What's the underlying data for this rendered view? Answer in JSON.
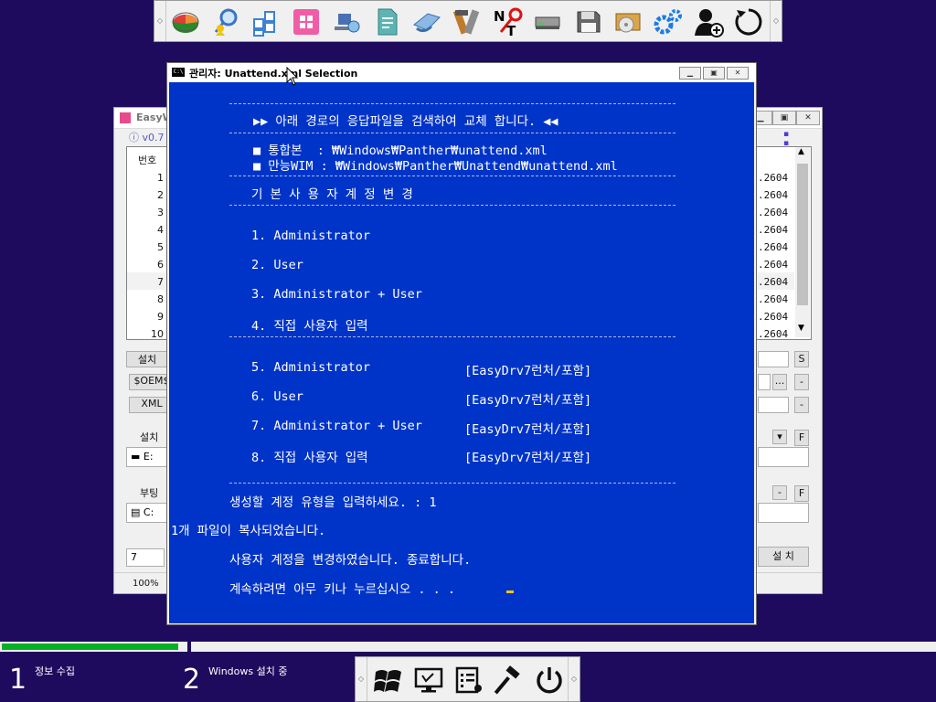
{
  "top_toolbar": {
    "icons": [
      "partition-icon",
      "search-user-icon",
      "tiles-icon",
      "windows-logo-icon",
      "network-icon",
      "document-icon",
      "driver-icon",
      "tools-icon",
      "nt-key-icon",
      "drive-icon",
      "floppy-icon",
      "disc-box-icon",
      "gears-icon",
      "add-user-icon",
      "refresh-icon"
    ]
  },
  "background_window": {
    "title": "EasyW",
    "version": "ⓘ v0.7",
    "list_header": "번호",
    "row_numbers": [
      "1",
      "2",
      "3",
      "4",
      "5",
      "6",
      "7",
      "8",
      "9",
      "10"
    ],
    "row_values": [
      ".2604",
      ".2604",
      ".2604",
      ".2604",
      ".2604",
      ".2604",
      ".2604",
      ".2604",
      ".2604",
      ".2604"
    ],
    "labels": {
      "install1": "설치",
      "oem": "$OEM$",
      "xml": "XML",
      "install2": "설치",
      "drive_e": "E:",
      "boot": "부팅",
      "drive_c": "C:",
      "count": "7",
      "install_button": "설 치",
      "zoom": "100%",
      "s": "S",
      "browse": "...",
      "minus": "-",
      "f": "F",
      "dropdown": "▾"
    }
  },
  "console": {
    "title": "관리자: Unattend.xml Selection",
    "rule": "----------------------------------------------------------------------",
    "header_line": "▶▶ 아래 경로의 응답파일을 검색하여 교체 합니다. ◀◀",
    "path1": "■ 통합본  : ₩Windows₩Panther₩unattend.xml",
    "path2": "■ 만능WIM : ₩Windows₩Panther₩Unattend₩unattend.xml",
    "section_title": "기 본 사 용 자 계 정 변 경",
    "options": [
      {
        "label": "1. Administrator",
        "tag": ""
      },
      {
        "label": "2. User",
        "tag": ""
      },
      {
        "label": "3. Administrator + User",
        "tag": ""
      },
      {
        "label": "4. 직접 사용자 입력",
        "tag": ""
      },
      {
        "label": "5. Administrator",
        "tag": "[EasyDrv7런처/포함]"
      },
      {
        "label": "6. User",
        "tag": "[EasyDrv7런처/포함]"
      },
      {
        "label": "7. Administrator + User",
        "tag": "[EasyDrv7런처/포함]"
      },
      {
        "label": "8. 직접 사용자 입력",
        "tag": "[EasyDrv7런처/포함]"
      }
    ],
    "prompt": "생성할 계정 유형을 입력하세요. : 1",
    "copied": "1개 파일이 복사되었습니다.",
    "changed": "사용자 계정을 변경하였습니다. 종료합니다.",
    "press_key": "계속하려면 아무 키나 누르십시오 . . ."
  },
  "progress": {
    "step1_number": "1",
    "step1_label": "정보 수집",
    "step1_fraction": 0.96,
    "step2_number": "2",
    "step2_label": "Windows 설치 중",
    "step2_fraction": 0
  },
  "bottom_taskbar": {
    "icons": [
      "windows-flag-icon",
      "monitor-icon",
      "checklist-icon",
      "hammer-icon",
      "power-icon"
    ]
  },
  "colors": {
    "desktop": "#1e0b5e",
    "console_bg": "#0034c8",
    "progress_green": "#06b025",
    "cursor_yellow": "#f1c40f"
  }
}
